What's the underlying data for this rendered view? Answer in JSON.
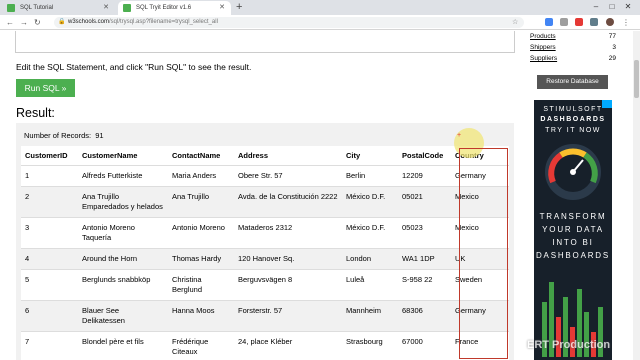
{
  "browser": {
    "tabs": [
      {
        "label": "SQL Tutorial",
        "active": false
      },
      {
        "label": "SQL Tryit Editor v1.6",
        "active": true
      }
    ],
    "new_tab_icon": "plus-icon",
    "window_buttons": [
      "–",
      "□",
      "✕"
    ],
    "url_host": "w3schools.com",
    "url_path": "/sql/trysql.asp?filename=trysql_select_all"
  },
  "page": {
    "instruction": "Edit the SQL Statement, and click \"Run SQL\" to see the result.",
    "run_button": "Run SQL »",
    "result_title": "Result:",
    "records_label": "Number of Records:",
    "records_count": "91"
  },
  "table": {
    "columns": [
      "CustomerID",
      "CustomerName",
      "ContactName",
      "Address",
      "City",
      "PostalCode",
      "Country"
    ],
    "rows": [
      [
        "1",
        "Alfreds Futterkiste",
        "Maria Anders",
        "Obere Str. 57",
        "Berlin",
        "12209",
        "Germany"
      ],
      [
        "2",
        "Ana Trujillo Emparedados y helados",
        "Ana Trujillo",
        "Avda. de la Constitución 2222",
        "México D.F.",
        "05021",
        "Mexico"
      ],
      [
        "3",
        "Antonio Moreno Taquería",
        "Antonio Moreno",
        "Mataderos 2312",
        "México D.F.",
        "05023",
        "Mexico"
      ],
      [
        "4",
        "Around the Horn",
        "Thomas Hardy",
        "120 Hanover Sq.",
        "London",
        "WA1 1DP",
        "UK"
      ],
      [
        "5",
        "Berglunds snabbköp",
        "Christina Berglund",
        "Berguvsvägen 8",
        "Luleå",
        "S-958 22",
        "Sweden"
      ],
      [
        "6",
        "Blauer See Delikatessen",
        "Hanna Moos",
        "Forsterstr. 57",
        "Mannheim",
        "68306",
        "Germany"
      ],
      [
        "7",
        "Blondel père et fils",
        "Frédérique Citeaux",
        "24, place Kléber",
        "Strasbourg",
        "67000",
        "France"
      ]
    ]
  },
  "sidebar": {
    "databases": [
      {
        "name": "Products",
        "count": "77"
      },
      {
        "name": "Shippers",
        "count": "3"
      },
      {
        "name": "Suppliers",
        "count": "29"
      }
    ],
    "restore_button": "Restore Database"
  },
  "ad": {
    "line1": "STIMULSOFT",
    "line2": "DASHBOARDS",
    "line3": "TRY IT NOW",
    "line4": "TRANSFORM",
    "line5": "YOUR DATA",
    "line6": "INTO BI",
    "line7": "DASHBOARDS"
  },
  "watermark": "ERT Production",
  "colors": {
    "run_button": "#4caf50",
    "highlight_border": "#c0392b",
    "restore_button": "#555555",
    "ad_background": "#17202a"
  }
}
